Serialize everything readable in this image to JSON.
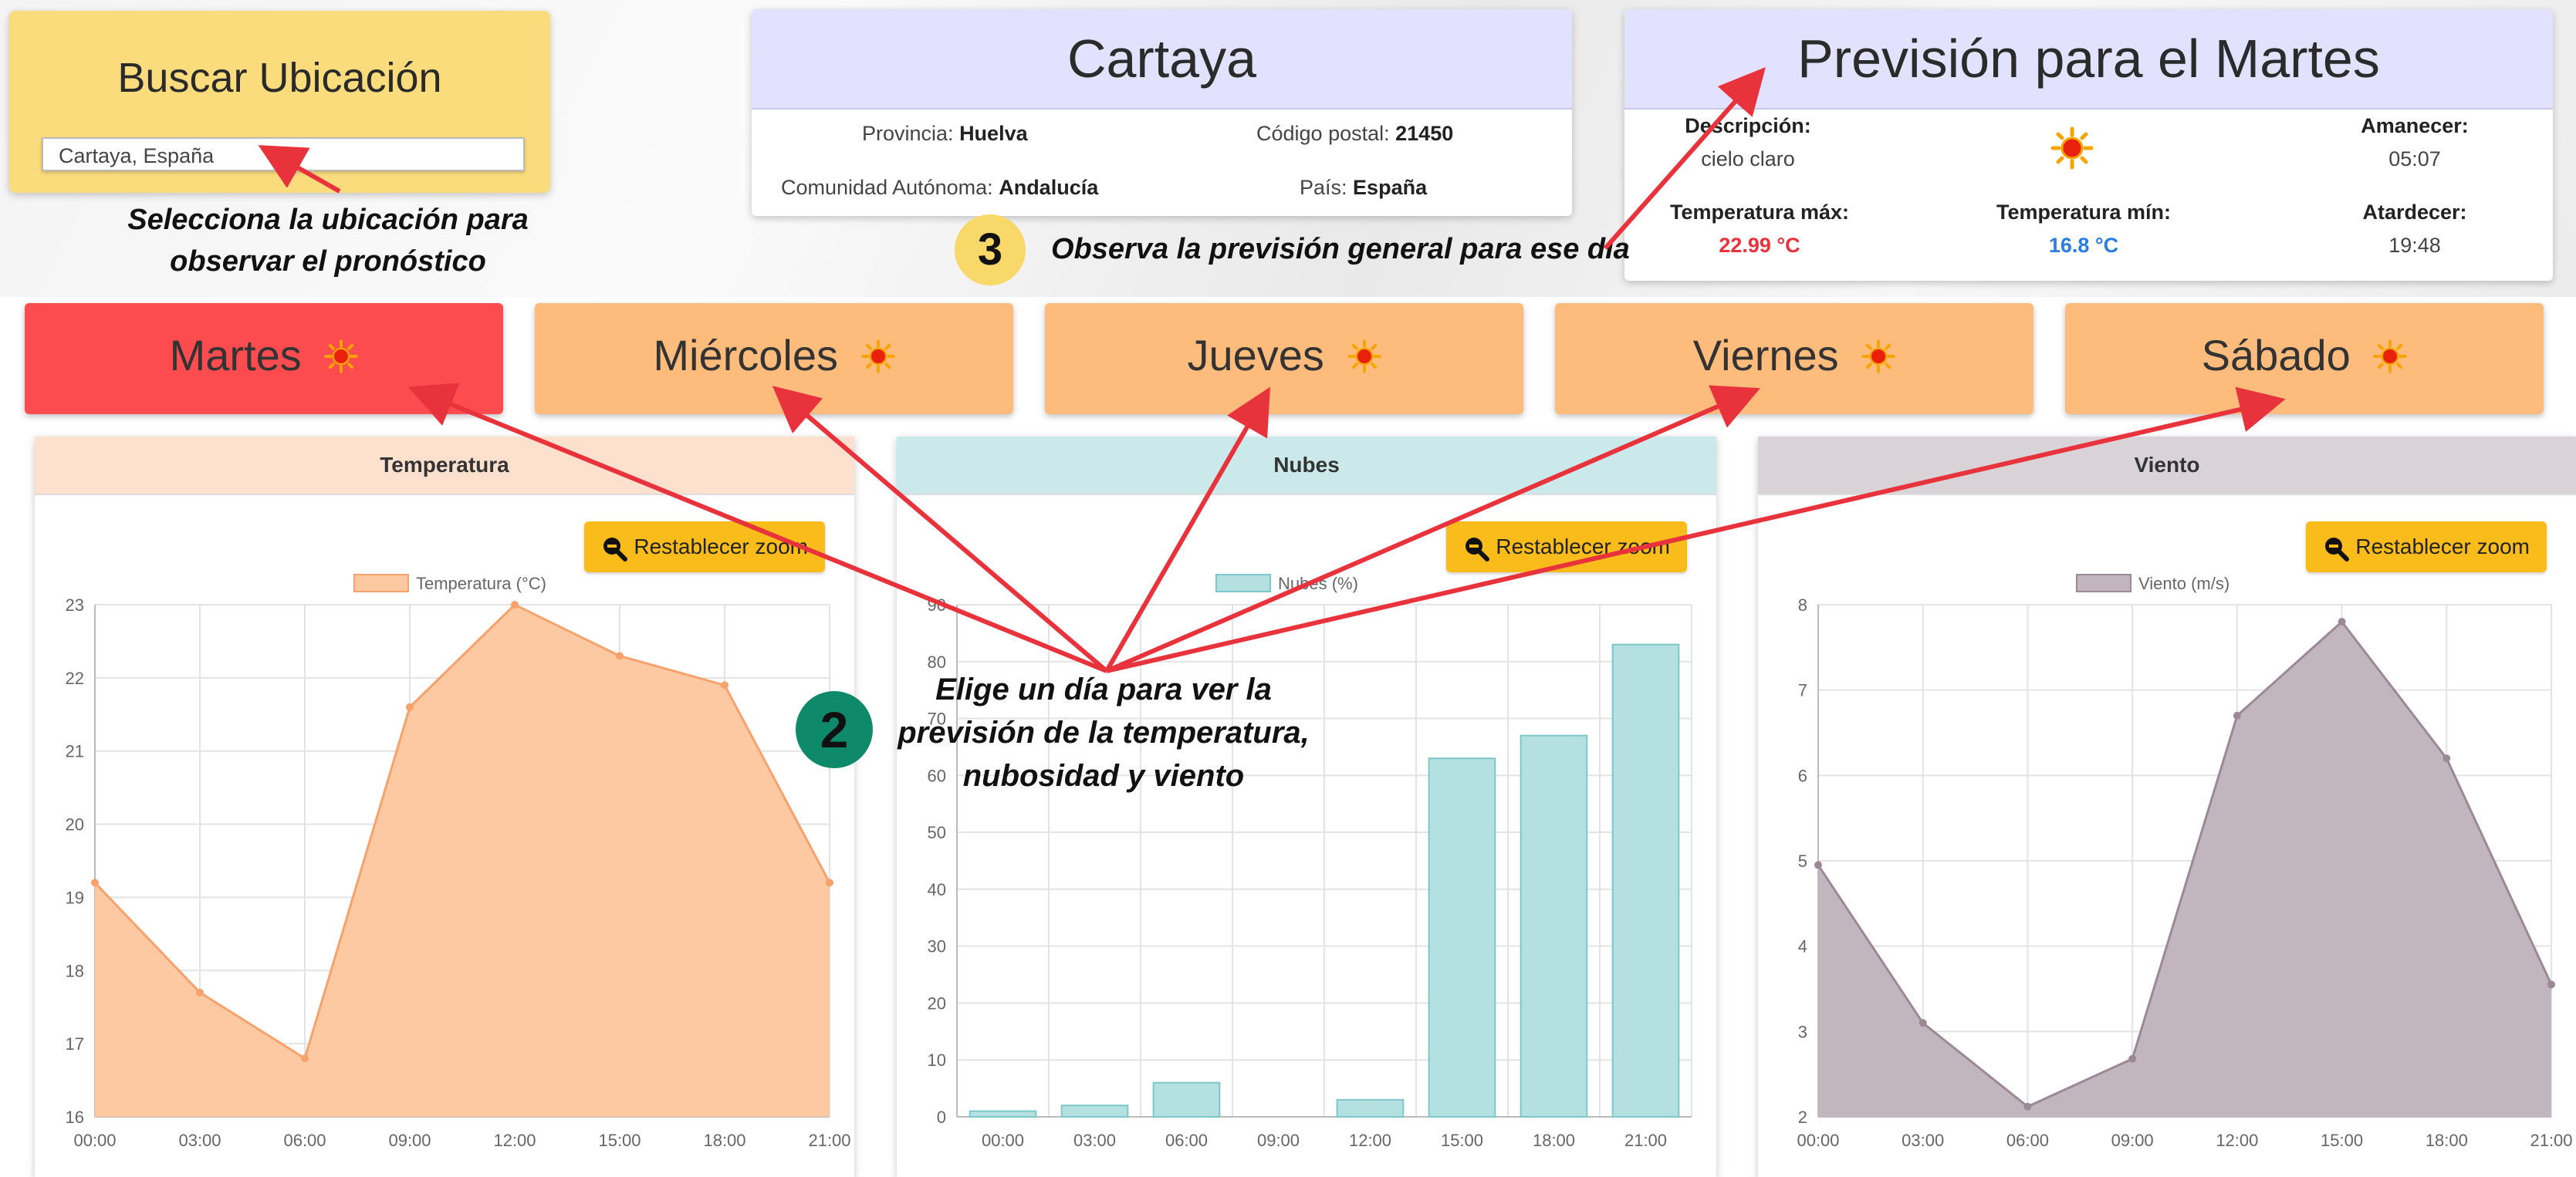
{
  "search": {
    "title": "Buscar Ubicación",
    "value": "Cartaya, España"
  },
  "location": {
    "city": "Cartaya",
    "provincia_label": "Provincia:",
    "provincia": "Huelva",
    "cp_label": "Código postal:",
    "cp": "21450",
    "comunidad_label": "Comunidad Autónoma:",
    "comunidad": "Andalucía",
    "pais_label": "País:",
    "pais": "España"
  },
  "forecast": {
    "title": "Previsión para el Martes",
    "desc_label": "Descripción:",
    "desc": "cielo claro",
    "sunrise_label": "Amanecer:",
    "sunrise": "05:07",
    "tmax_label": "Temperatura máx:",
    "tmax": "22.99 °C",
    "tmin_label": "Temperatura mín:",
    "tmin": "16.8 °C",
    "sunset_label": "Atardecer:",
    "sunset": "19:48"
  },
  "notes": {
    "n1_line1": "Selecciona la ubicación para",
    "n1_line2": "observar el pronóstico",
    "n3_num": "3",
    "n3": "Observa la previsión general para ese día",
    "n2_num": "2",
    "n2_line1": "Elige un día para ver la",
    "n2_line2": "previsión de la temperatura,",
    "n2_line3": "nubosidad y viento"
  },
  "days": [
    "Martes",
    "Miércoles",
    "Jueves",
    "Viernes",
    "Sábado"
  ],
  "active_day": "Martes",
  "zoom_label": "Restablecer zoom",
  "panels": {
    "temp": "Temperatura",
    "clouds": "Nubes",
    "wind": "Viento"
  },
  "colors": {
    "temp_fill": "#fdc9a2",
    "temp_line": "#f5a26c",
    "cloud_fill": "#b4e0e1",
    "cloud_line": "#7cc7c9",
    "wind_fill": "#c1b5be",
    "wind_line": "#9b8a96",
    "annotation": "#e8323c",
    "active_day": "#fd4c50",
    "day": "#fdbb7c",
    "zoom": "#f9bc1b"
  },
  "chart_data": [
    {
      "type": "area",
      "legend": "Temperatura (°C)",
      "x": [
        "00:00",
        "03:00",
        "06:00",
        "09:00",
        "12:00",
        "15:00",
        "18:00",
        "21:00"
      ],
      "values": [
        19.2,
        17.7,
        16.8,
        21.6,
        23.0,
        22.3,
        21.9,
        19.2
      ],
      "ylim": [
        16,
        23
      ],
      "yticks": [
        16,
        17,
        18,
        19,
        20,
        21,
        22,
        23
      ],
      "grid": true,
      "legend_position": "top"
    },
    {
      "type": "bar",
      "legend": "Nubes (%)",
      "x": [
        "00:00",
        "03:00",
        "06:00",
        "09:00",
        "12:00",
        "15:00",
        "18:00",
        "21:00"
      ],
      "values": [
        1,
        2,
        6,
        0,
        3,
        63,
        67,
        83
      ],
      "ylim": [
        0,
        90
      ],
      "yticks": [
        0,
        10,
        20,
        30,
        40,
        50,
        60,
        70,
        80,
        90
      ],
      "grid": true,
      "legend_position": "top"
    },
    {
      "type": "area",
      "legend": "Viento (m/s)",
      "x": [
        "00:00",
        "03:00",
        "06:00",
        "09:00",
        "12:00",
        "15:00",
        "18:00",
        "21:00"
      ],
      "values": [
        4.95,
        3.1,
        2.12,
        2.68,
        6.7,
        7.8,
        6.2,
        3.55
      ],
      "ylim": [
        2,
        8
      ],
      "yticks": [
        2,
        3,
        4,
        5,
        6,
        7,
        8
      ],
      "grid": true,
      "legend_position": "top"
    }
  ]
}
